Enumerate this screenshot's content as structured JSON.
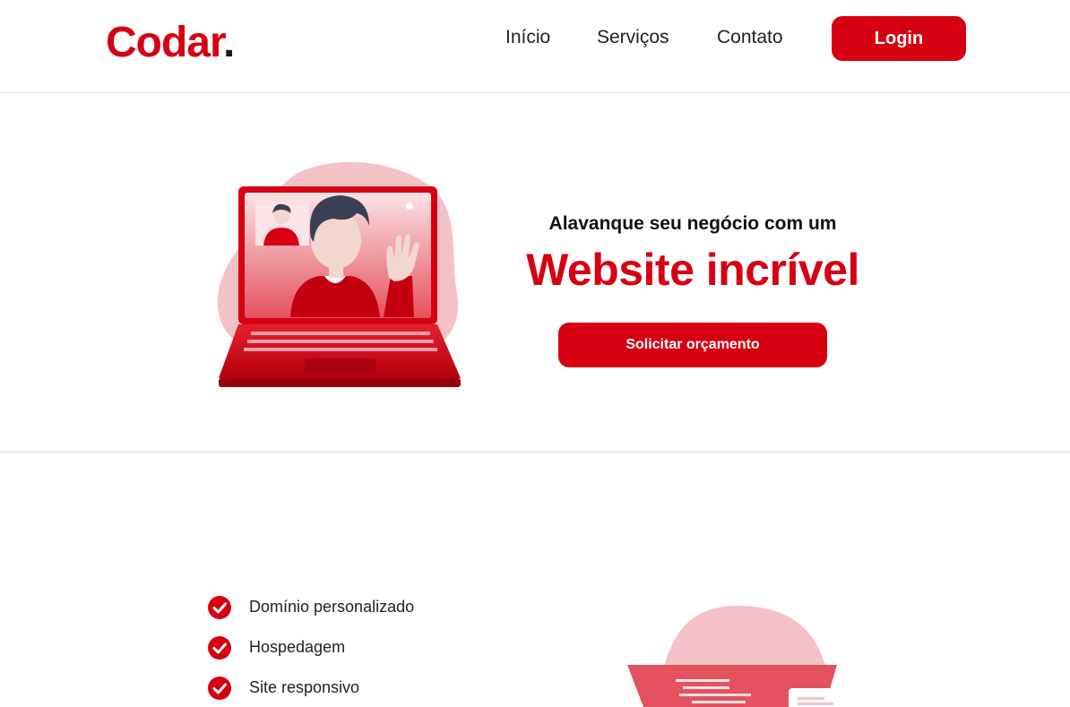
{
  "header": {
    "logo_text": "Codar",
    "logo_dot": ".",
    "nav": [
      "Início",
      "Serviços",
      "Contato"
    ],
    "login_label": "Login"
  },
  "hero": {
    "tagline": "Alavanque seu negócio com um",
    "headline": "Website incrível",
    "cta_label": "Solicitar orçamento"
  },
  "features": {
    "items": [
      "Domínio personalizado",
      "Hospedagem",
      "Site responsivo"
    ]
  },
  "colors": {
    "brand": "#d60012",
    "blob": "#f4c2c6"
  }
}
